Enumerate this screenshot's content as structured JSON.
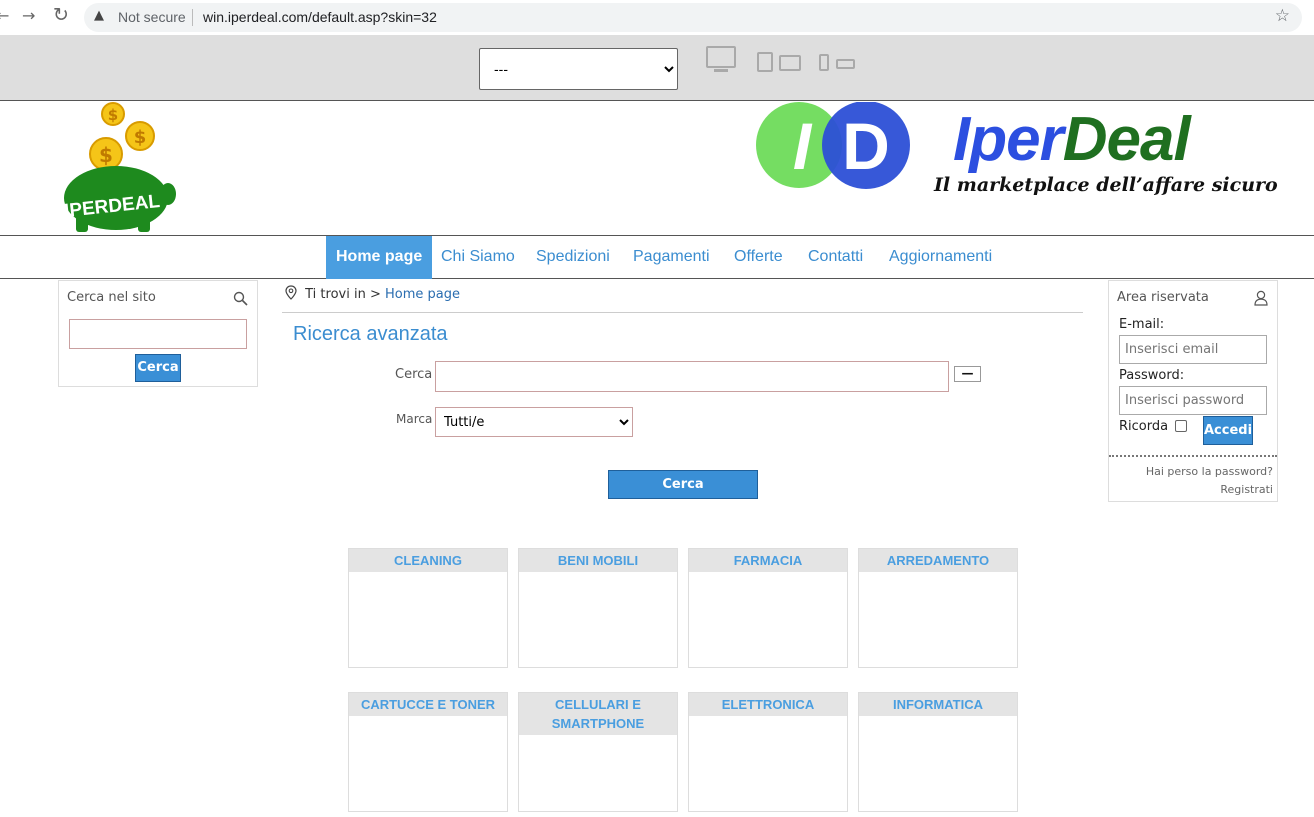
{
  "browser": {
    "security_label": "Not secure",
    "url": "win.iperdeal.com/default.asp?skin=32"
  },
  "skin_selector": {
    "selected": "---"
  },
  "header": {
    "logo_text": "IPERDEAL",
    "brand_name_a": "Iper",
    "brand_name_b": "Deal",
    "brand_initial_1": "I",
    "brand_initial_2": "D",
    "tagline": "Il marketplace dell’affare sicuro"
  },
  "menu": {
    "items": [
      {
        "label": "Home page"
      },
      {
        "label": "Chi Siamo"
      },
      {
        "label": "Spedizioni"
      },
      {
        "label": "Pagamenti"
      },
      {
        "label": "Offerte"
      },
      {
        "label": "Contatti"
      },
      {
        "label": "Aggiornamenti"
      }
    ]
  },
  "site_search": {
    "title": "Cerca nel sito",
    "button": "Cerca"
  },
  "breadcrumb": {
    "prefix": "Ti trovi in",
    "separator": ">",
    "current": "Home page"
  },
  "advanced_search": {
    "title": "Ricerca avanzata",
    "cerca_label": "Cerca",
    "marca_label": "Marca",
    "marca_selected": "Tutti/e",
    "toggle_label": "—",
    "button": "Cerca"
  },
  "reserved_area": {
    "title": "Area riservata",
    "email_label": "E-mail:",
    "email_placeholder": "Inserisci email",
    "password_label": "Password:",
    "password_placeholder": "Inserisci password",
    "remember_label": "Ricorda",
    "login_button": "Accedi",
    "forgot_link": "Hai perso la password?",
    "register_link": "Registrati"
  },
  "categories": [
    {
      "name": "CLEANING"
    },
    {
      "name": "BENI MOBILI"
    },
    {
      "name": "FARMACIA"
    },
    {
      "name": "ARREDAMENTO"
    },
    {
      "name": "CARTUCCE E TONER"
    },
    {
      "name": "CELLULARI E SMARTPHONE"
    },
    {
      "name": "ELETTRONICA"
    },
    {
      "name": "INFORMATICA"
    }
  ],
  "colors": {
    "accent": "#4a9ee0",
    "button": "#3a8fd6",
    "brand_blue": "#2c4fe0",
    "brand_green": "#1f6f20"
  }
}
